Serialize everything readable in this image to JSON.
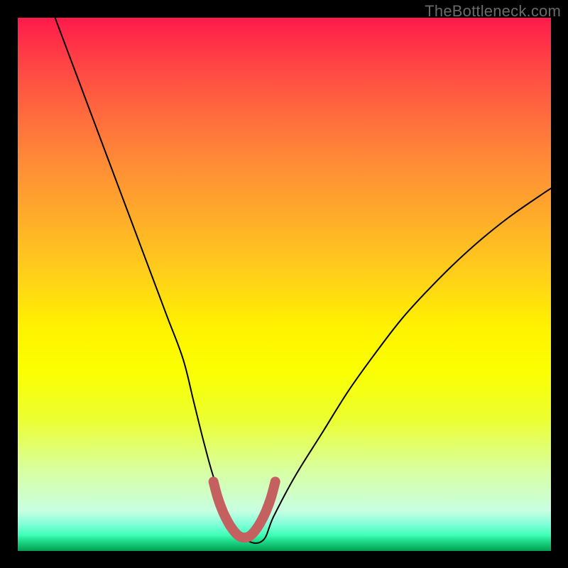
{
  "watermark": {
    "text": "TheBottleneck.com"
  },
  "chart_data": {
    "type": "line",
    "title": "",
    "xlabel": "",
    "ylabel": "",
    "xlim": [
      0,
      100
    ],
    "ylim": [
      0,
      100
    ],
    "grid": false,
    "legend": false,
    "background_gradient": {
      "direction": "vertical",
      "stops": [
        {
          "pct": 0,
          "color": "#ff1a4a"
        },
        {
          "pct": 30,
          "color": "#ff9a2e"
        },
        {
          "pct": 58,
          "color": "#fff200"
        },
        {
          "pct": 85,
          "color": "#d8ffa2"
        },
        {
          "pct": 100,
          "color": "#00a050"
        }
      ]
    },
    "series": [
      {
        "name": "bottleneck-curve",
        "color": "#000000",
        "x": [
          7.0,
          10.0,
          13.0,
          16.0,
          19.0,
          22.0,
          25.0,
          28.0,
          31.0,
          33.0,
          35.0,
          37.0,
          40.0,
          43.0,
          46.0,
          48.0,
          52.0,
          57.0,
          62.0,
          67.0,
          72.0,
          77.0,
          82.0,
          87.0,
          92.0,
          97.0,
          100.0
        ],
        "y": [
          100.0,
          92.0,
          84.0,
          76.0,
          68.0,
          60.0,
          52.0,
          44.0,
          36.0,
          28.0,
          20.0,
          13.0,
          5.5,
          2.0,
          2.0,
          6.5,
          14.0,
          22.0,
          30.0,
          37.0,
          43.5,
          49.0,
          54.0,
          58.5,
          62.5,
          66.0,
          68.0
        ]
      },
      {
        "name": "sweet-spot-band",
        "color": "#c46060",
        "thick": true,
        "x": [
          36.7,
          37.5,
          38.5,
          39.5,
          40.5,
          41.5,
          42.5,
          43.5,
          44.5,
          45.5,
          46.5,
          47.5,
          48.3
        ],
        "y": [
          13.0,
          10.0,
          7.3,
          5.3,
          3.8,
          2.8,
          2.5,
          2.8,
          3.8,
          5.3,
          7.3,
          10.0,
          13.0
        ]
      }
    ]
  }
}
